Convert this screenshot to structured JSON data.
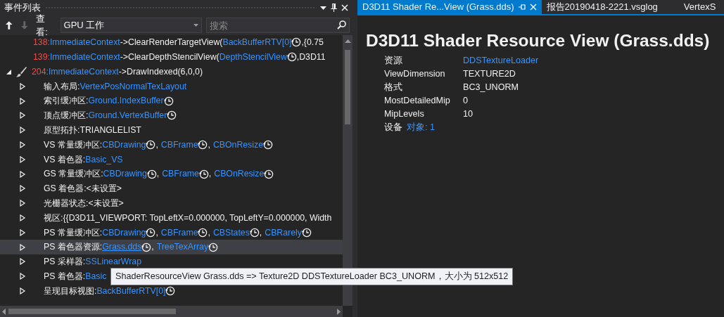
{
  "event_panel": {
    "title": "事件列表",
    "toolbar": {
      "up_disabled": false,
      "down_disabled": true,
      "view_label": "查看:",
      "view_value": "GPU 工作",
      "search_placeholder": "搜索"
    },
    "events": [
      {
        "parts": [
          {
            "kind": "num",
            "text": "138:"
          },
          {
            "kind": "link",
            "text": "ImmediateContext"
          },
          {
            "kind": "text",
            "text": "->ClearRenderTargetView("
          },
          {
            "kind": "link",
            "text": "BackBufferRTV[0]"
          },
          {
            "kind": "clock"
          },
          {
            "kind": "text",
            "text": ",{0.75"
          }
        ]
      },
      {
        "parts": [
          {
            "kind": "num",
            "text": "139:"
          },
          {
            "kind": "link",
            "text": "ImmediateContext"
          },
          {
            "kind": "text",
            "text": "->ClearDepthStencilView("
          },
          {
            "kind": "link",
            "text": "DepthStencilView"
          },
          {
            "kind": "clock"
          },
          {
            "kind": "text",
            "text": ",D3D11"
          }
        ]
      },
      {
        "expanded": true,
        "kind": "draw",
        "parts": [
          {
            "kind": "num",
            "text": "204:"
          },
          {
            "kind": "link",
            "text": "ImmediateContext"
          },
          {
            "kind": "text",
            "text": "->DrawIndexed(6,0,0)"
          }
        ],
        "children": [
          {
            "expanded": false,
            "selected": false,
            "parts": [
              {
                "kind": "text",
                "text": "输入布局:"
              },
              {
                "kind": "link",
                "text": "VertexPosNormalTexLayout"
              }
            ]
          },
          {
            "expanded": false,
            "selected": false,
            "parts": [
              {
                "kind": "text",
                "text": "索引缓冲区:"
              },
              {
                "kind": "link",
                "text": "Ground.IndexBuffer"
              },
              {
                "kind": "clock"
              }
            ]
          },
          {
            "expanded": false,
            "selected": false,
            "parts": [
              {
                "kind": "text",
                "text": "顶点缓冲区:"
              },
              {
                "kind": "link",
                "text": "Ground.VertexBuffer"
              },
              {
                "kind": "clock"
              }
            ]
          },
          {
            "expanded": false,
            "selected": false,
            "parts": [
              {
                "kind": "text",
                "text": "原型拓扑:TRIANGLELIST"
              }
            ]
          },
          {
            "expanded": false,
            "selected": false,
            "parts": [
              {
                "kind": "text",
                "text": "VS 常量缓冲区:"
              },
              {
                "kind": "link",
                "text": "CBDrawing"
              },
              {
                "kind": "clock"
              },
              {
                "kind": "text",
                "text": ","
              },
              {
                "kind": "link",
                "text": "CBFrame"
              },
              {
                "kind": "clock"
              },
              {
                "kind": "text",
                "text": ","
              },
              {
                "kind": "link",
                "text": "CBOnResize"
              },
              {
                "kind": "clock"
              }
            ]
          },
          {
            "expanded": false,
            "selected": false,
            "parts": [
              {
                "kind": "text",
                "text": "VS 着色器:"
              },
              {
                "kind": "link",
                "text": "Basic_VS"
              }
            ]
          },
          {
            "expanded": false,
            "selected": false,
            "parts": [
              {
                "kind": "text",
                "text": "GS 常量缓冲区:"
              },
              {
                "kind": "link",
                "text": "CBDrawing"
              },
              {
                "kind": "clock"
              },
              {
                "kind": "text",
                "text": ","
              },
              {
                "kind": "link",
                "text": "CBFrame"
              },
              {
                "kind": "clock"
              },
              {
                "kind": "text",
                "text": ","
              },
              {
                "kind": "link",
                "text": "CBOnResize"
              },
              {
                "kind": "clock"
              }
            ]
          },
          {
            "expanded": false,
            "selected": false,
            "parts": [
              {
                "kind": "text",
                "text": "GS 着色器:<未设置>"
              }
            ]
          },
          {
            "expanded": false,
            "selected": false,
            "parts": [
              {
                "kind": "text",
                "text": "光栅器状态:<未设置>"
              }
            ]
          },
          {
            "expanded": false,
            "selected": false,
            "parts": [
              {
                "kind": "text",
                "text": "视区:{{D3D11_VIEWPORT: TopLeftX=0.000000, TopLeftY=0.000000, Width"
              }
            ]
          },
          {
            "expanded": false,
            "selected": false,
            "parts": [
              {
                "kind": "text",
                "text": "PS 常量缓冲区:"
              },
              {
                "kind": "link",
                "text": "CBDrawing"
              },
              {
                "kind": "clock"
              },
              {
                "kind": "text",
                "text": ","
              },
              {
                "kind": "link",
                "text": "CBFrame"
              },
              {
                "kind": "clock"
              },
              {
                "kind": "text",
                "text": ","
              },
              {
                "kind": "link",
                "text": "CBStates"
              },
              {
                "kind": "clock"
              },
              {
                "kind": "text",
                "text": ","
              },
              {
                "kind": "link",
                "text": "CBRarely"
              },
              {
                "kind": "clock"
              }
            ]
          },
          {
            "expanded": false,
            "selected": true,
            "parts": [
              {
                "kind": "text",
                "text": "PS 着色器资源:"
              },
              {
                "kind": "link",
                "text": "Grass.dds",
                "underline": true
              },
              {
                "kind": "clock"
              },
              {
                "kind": "text",
                "text": ","
              },
              {
                "kind": "link",
                "text": "TreeTexArray"
              },
              {
                "kind": "clock"
              }
            ]
          },
          {
            "expanded": false,
            "selected": false,
            "parts": [
              {
                "kind": "text",
                "text": "PS 采样器:"
              },
              {
                "kind": "link",
                "text": "SSLinearWrap"
              }
            ]
          },
          {
            "expanded": false,
            "selected": false,
            "parts": [
              {
                "kind": "text",
                "text": "PS 着色器:"
              },
              {
                "kind": "link",
                "text": "Basic"
              }
            ]
          },
          {
            "expanded": false,
            "selected": false,
            "parts": [
              {
                "kind": "text",
                "text": "呈现目标视图:"
              },
              {
                "kind": "link",
                "text": "BackBufferRTV[0]"
              },
              {
                "kind": "clock"
              }
            ]
          }
        ]
      }
    ],
    "tooltip": "ShaderResourceView Grass.dds => Texture2D DDSTextureLoader BC3_UNORM，大小为 512x512"
  },
  "document": {
    "tabs": [
      {
        "label": "D3D11 Shader Re...View (Grass.dds)",
        "selected": true
      },
      {
        "label": "报告20190418-2221.vsglog",
        "selected": false
      },
      {
        "label": "VertexS",
        "selected": false
      }
    ],
    "heading": "D3D11 Shader Resource View (Grass.dds)",
    "properties": [
      {
        "kind": "row",
        "label": "资源",
        "value": "DDSTextureLoader",
        "link": true
      },
      {
        "kind": "row",
        "label": "ViewDimension",
        "value": "TEXTURE2D",
        "link": false
      },
      {
        "kind": "row",
        "label": "格式",
        "value": "BC3_UNORM",
        "link": false
      },
      {
        "kind": "row",
        "label": "MostDetailedMip",
        "value": "0",
        "link": false
      },
      {
        "kind": "row",
        "label": "MipLevels",
        "value": "10",
        "link": false
      },
      {
        "kind": "inline",
        "label": "设备",
        "value": "对象: 1",
        "link": true
      }
    ]
  }
}
